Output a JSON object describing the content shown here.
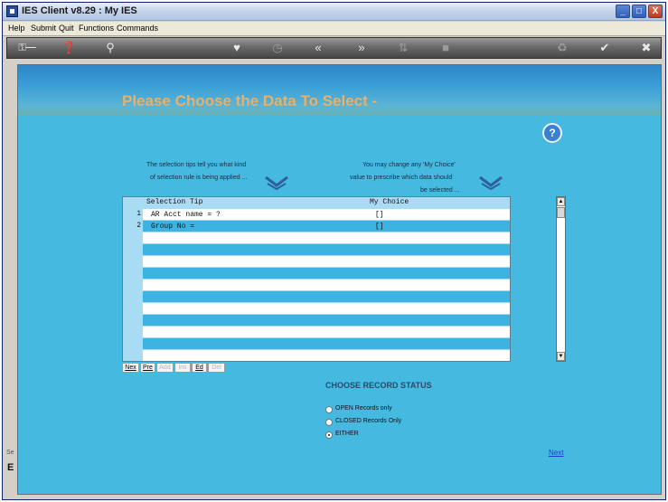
{
  "window": {
    "title": "IES Client v8.29 : My IES",
    "controls": {
      "minimize": "_",
      "maximize": "□",
      "close": "X"
    }
  },
  "menu": {
    "items": [
      "Help",
      "Submit",
      "Quit",
      "Functions",
      "Commands"
    ]
  },
  "toolbar": {
    "icons": [
      "key-icon",
      "help-circle-icon",
      "search-icon",
      "heart-icon",
      "clock-icon",
      "rewind-icon",
      "fast-forward-icon",
      "sort-icon",
      "stop-icon",
      "recycle-icon",
      "checkmark-icon",
      "close-icon"
    ]
  },
  "page": {
    "heading": "Please Choose the Data To Select -",
    "help_glyph": "?",
    "tip_left_line1": "The selection tips tell you what kind",
    "tip_left_line2": "of selection rule is being applied ...",
    "tip_right_line1": "You may change any 'My Choice'",
    "tip_right_line2": "value to prescribe which data should",
    "tip_right_line3": "be selected ..."
  },
  "grid": {
    "columns": [
      "Selection Tip",
      "My Choice"
    ],
    "rows": [
      {
        "num": "1",
        "tip": "AR Acct name = ?",
        "choice": "[]"
      },
      {
        "num": "2",
        "tip": "Group No =",
        "choice": "[]"
      }
    ],
    "buttons": [
      {
        "label": "Nex",
        "enabled": true
      },
      {
        "label": "Pre",
        "enabled": true
      },
      {
        "label": "Add",
        "enabled": false
      },
      {
        "label": "Ins",
        "enabled": false
      },
      {
        "label": "Ed",
        "enabled": true
      },
      {
        "label": "Del",
        "enabled": false
      }
    ]
  },
  "status": {
    "heading": "CHOOSE RECORD STATUS",
    "options": [
      {
        "label": "OPEN Records only",
        "selected": false
      },
      {
        "label": "CLOSED Records Only",
        "selected": false
      },
      {
        "label": "EITHER",
        "selected": true
      }
    ]
  },
  "nav": {
    "next_label": "Next"
  },
  "left_strip": {
    "t1": "Se",
    "t2": "E"
  }
}
